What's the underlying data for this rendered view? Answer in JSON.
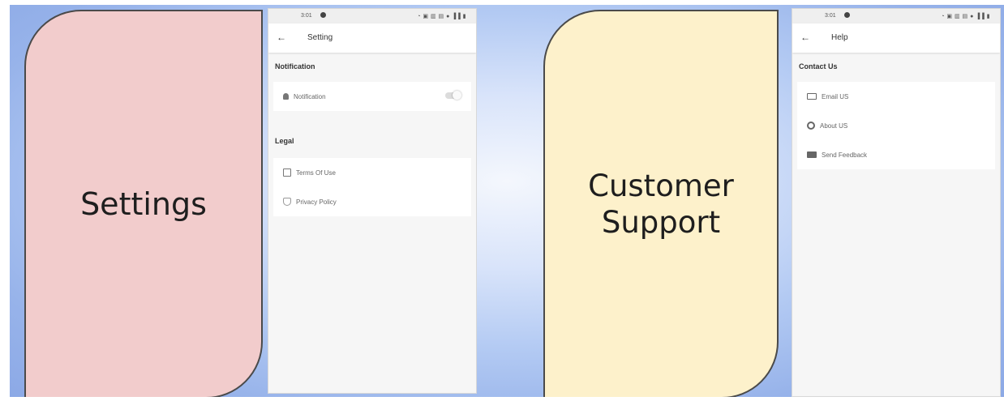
{
  "left_panel": {
    "card_line1": "Settings",
    "phone": {
      "status": {
        "time": "3:01",
        "icons": "◔ ▣ ▥ ▤ ● ▐▐ ▮"
      },
      "appbar": {
        "back_icon": "arrow-left",
        "title": "Setting"
      },
      "sections": [
        {
          "title": "Notification",
          "items": [
            {
              "label": "Notification",
              "icon": "bell-icon",
              "toggle": true
            }
          ]
        },
        {
          "title": "Legal",
          "items": [
            {
              "label": "Terms Of Use",
              "icon": "document-icon"
            },
            {
              "label": "Privacy Policy",
              "icon": "shield-icon"
            }
          ]
        }
      ]
    }
  },
  "right_panel": {
    "card_line1": "Customer",
    "card_line2": "Support",
    "phone": {
      "status": {
        "time": "3:01",
        "icons": "◔ ▣ ▥ ▤ ● ▐▐ ▮"
      },
      "appbar": {
        "back_icon": "arrow-left",
        "title": "Help"
      },
      "sections": [
        {
          "title": "Contact Us",
          "items": [
            {
              "label": "Email US",
              "icon": "mail-icon"
            },
            {
              "label": "About US",
              "icon": "info-icon"
            },
            {
              "label": "Send Feedback",
              "icon": "feedback-icon"
            }
          ]
        }
      ]
    }
  },
  "colors": {
    "settings_card": "#f2cccc",
    "support_card": "#fdf1cb",
    "background": "#97b3ea"
  }
}
